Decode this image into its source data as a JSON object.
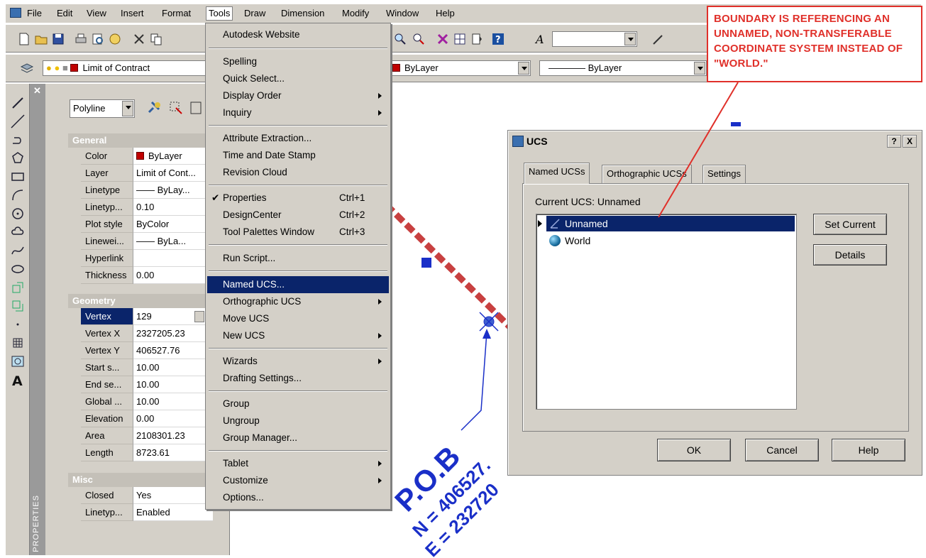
{
  "menubar": {
    "items": [
      "File",
      "Edit",
      "View",
      "Insert",
      "Format",
      "Tools",
      "Draw",
      "Dimension",
      "Modify",
      "Window",
      "Help"
    ]
  },
  "layer_toolbar": {
    "layer_name": "Limit of Contract",
    "color": "ByLayer",
    "linetype": "———— ByLayer"
  },
  "properties": {
    "object_type": "Polyline",
    "side_title": "PROPERTIES",
    "sections": {
      "general": "General",
      "geometry": "Geometry",
      "misc": "Misc"
    },
    "general": [
      {
        "k": "Color",
        "v": "ByLayer"
      },
      {
        "k": "Layer",
        "v": "Limit of Cont..."
      },
      {
        "k": "Linetype",
        "v": "—— ByLay..."
      },
      {
        "k": "Linetyp...",
        "v": "0.10"
      },
      {
        "k": "Plot style",
        "v": "ByColor"
      },
      {
        "k": "Linewei...",
        "v": "—— ByLa..."
      },
      {
        "k": "Hyperlink",
        "v": ""
      },
      {
        "k": "Thickness",
        "v": "0.00"
      }
    ],
    "geometry": [
      {
        "k": "Vertex",
        "v": "129"
      },
      {
        "k": "Vertex X",
        "v": "2327205.23"
      },
      {
        "k": "Vertex Y",
        "v": "406527.76"
      },
      {
        "k": "Start s...",
        "v": "10.00"
      },
      {
        "k": "End se...",
        "v": "10.00"
      },
      {
        "k": "Global ...",
        "v": "10.00"
      },
      {
        "k": "Elevation",
        "v": "0.00"
      },
      {
        "k": "Area",
        "v": "2108301.23"
      },
      {
        "k": "Length",
        "v": "8723.61"
      }
    ],
    "misc": [
      {
        "k": "Closed",
        "v": "Yes"
      },
      {
        "k": "Linetyp...",
        "v": "Enabled"
      }
    ]
  },
  "tools_menu": {
    "items": [
      {
        "label": "Autodesk Website",
        "shortcut": ""
      },
      {
        "label": "Spelling",
        "shortcut": ""
      },
      {
        "label": "Quick Select...",
        "shortcut": ""
      },
      {
        "label": "Display Order",
        "shortcut": ""
      },
      {
        "label": "Inquiry",
        "shortcut": ""
      },
      {
        "label": "Attribute Extraction...",
        "shortcut": ""
      },
      {
        "label": "Time and Date Stamp",
        "shortcut": ""
      },
      {
        "label": "Revision Cloud",
        "shortcut": ""
      },
      {
        "label": "Properties",
        "shortcut": "Ctrl+1"
      },
      {
        "label": "DesignCenter",
        "shortcut": "Ctrl+2"
      },
      {
        "label": "Tool Palettes Window",
        "shortcut": "Ctrl+3"
      },
      {
        "label": "Run Script...",
        "shortcut": ""
      },
      {
        "label": "Named UCS...",
        "shortcut": ""
      },
      {
        "label": "Orthographic UCS",
        "shortcut": ""
      },
      {
        "label": "Move UCS",
        "shortcut": ""
      },
      {
        "label": "New UCS",
        "shortcut": ""
      },
      {
        "label": "Wizards",
        "shortcut": ""
      },
      {
        "label": "Drafting Settings...",
        "shortcut": ""
      },
      {
        "label": "Group",
        "shortcut": ""
      },
      {
        "label": "Ungroup",
        "shortcut": ""
      },
      {
        "label": "Group Manager...",
        "shortcut": ""
      },
      {
        "label": "Tablet",
        "shortcut": ""
      },
      {
        "label": "Customize",
        "shortcut": ""
      },
      {
        "label": "Options...",
        "shortcut": ""
      }
    ]
  },
  "ucs_dialog": {
    "title": "UCS",
    "help_btn": "?",
    "close_btn": "X",
    "tabs": [
      "Named UCSs",
      "Orthographic UCSs",
      "Settings"
    ],
    "current_label": "Current UCS:  Unnamed",
    "list": [
      "Unnamed",
      "World"
    ],
    "set_current": "Set Current",
    "details": "Details",
    "ok": "OK",
    "cancel": "Cancel",
    "help": "Help"
  },
  "drawing": {
    "pob_label": "P.O.B",
    "north": "N = 406527.",
    "east": "E = 232720"
  },
  "annotation": {
    "text": "BOUNDARY IS REFERENCING AN UNNAMED, NON-TRANSFERABLE COORDINATE SYSTEM INSTEAD OF \"WORLD.\""
  },
  "colors": {
    "selection": "#0a246a",
    "annotation": "#e0302a",
    "cad_blue": "#1a2fc8",
    "boundary_red": "#c84040"
  }
}
